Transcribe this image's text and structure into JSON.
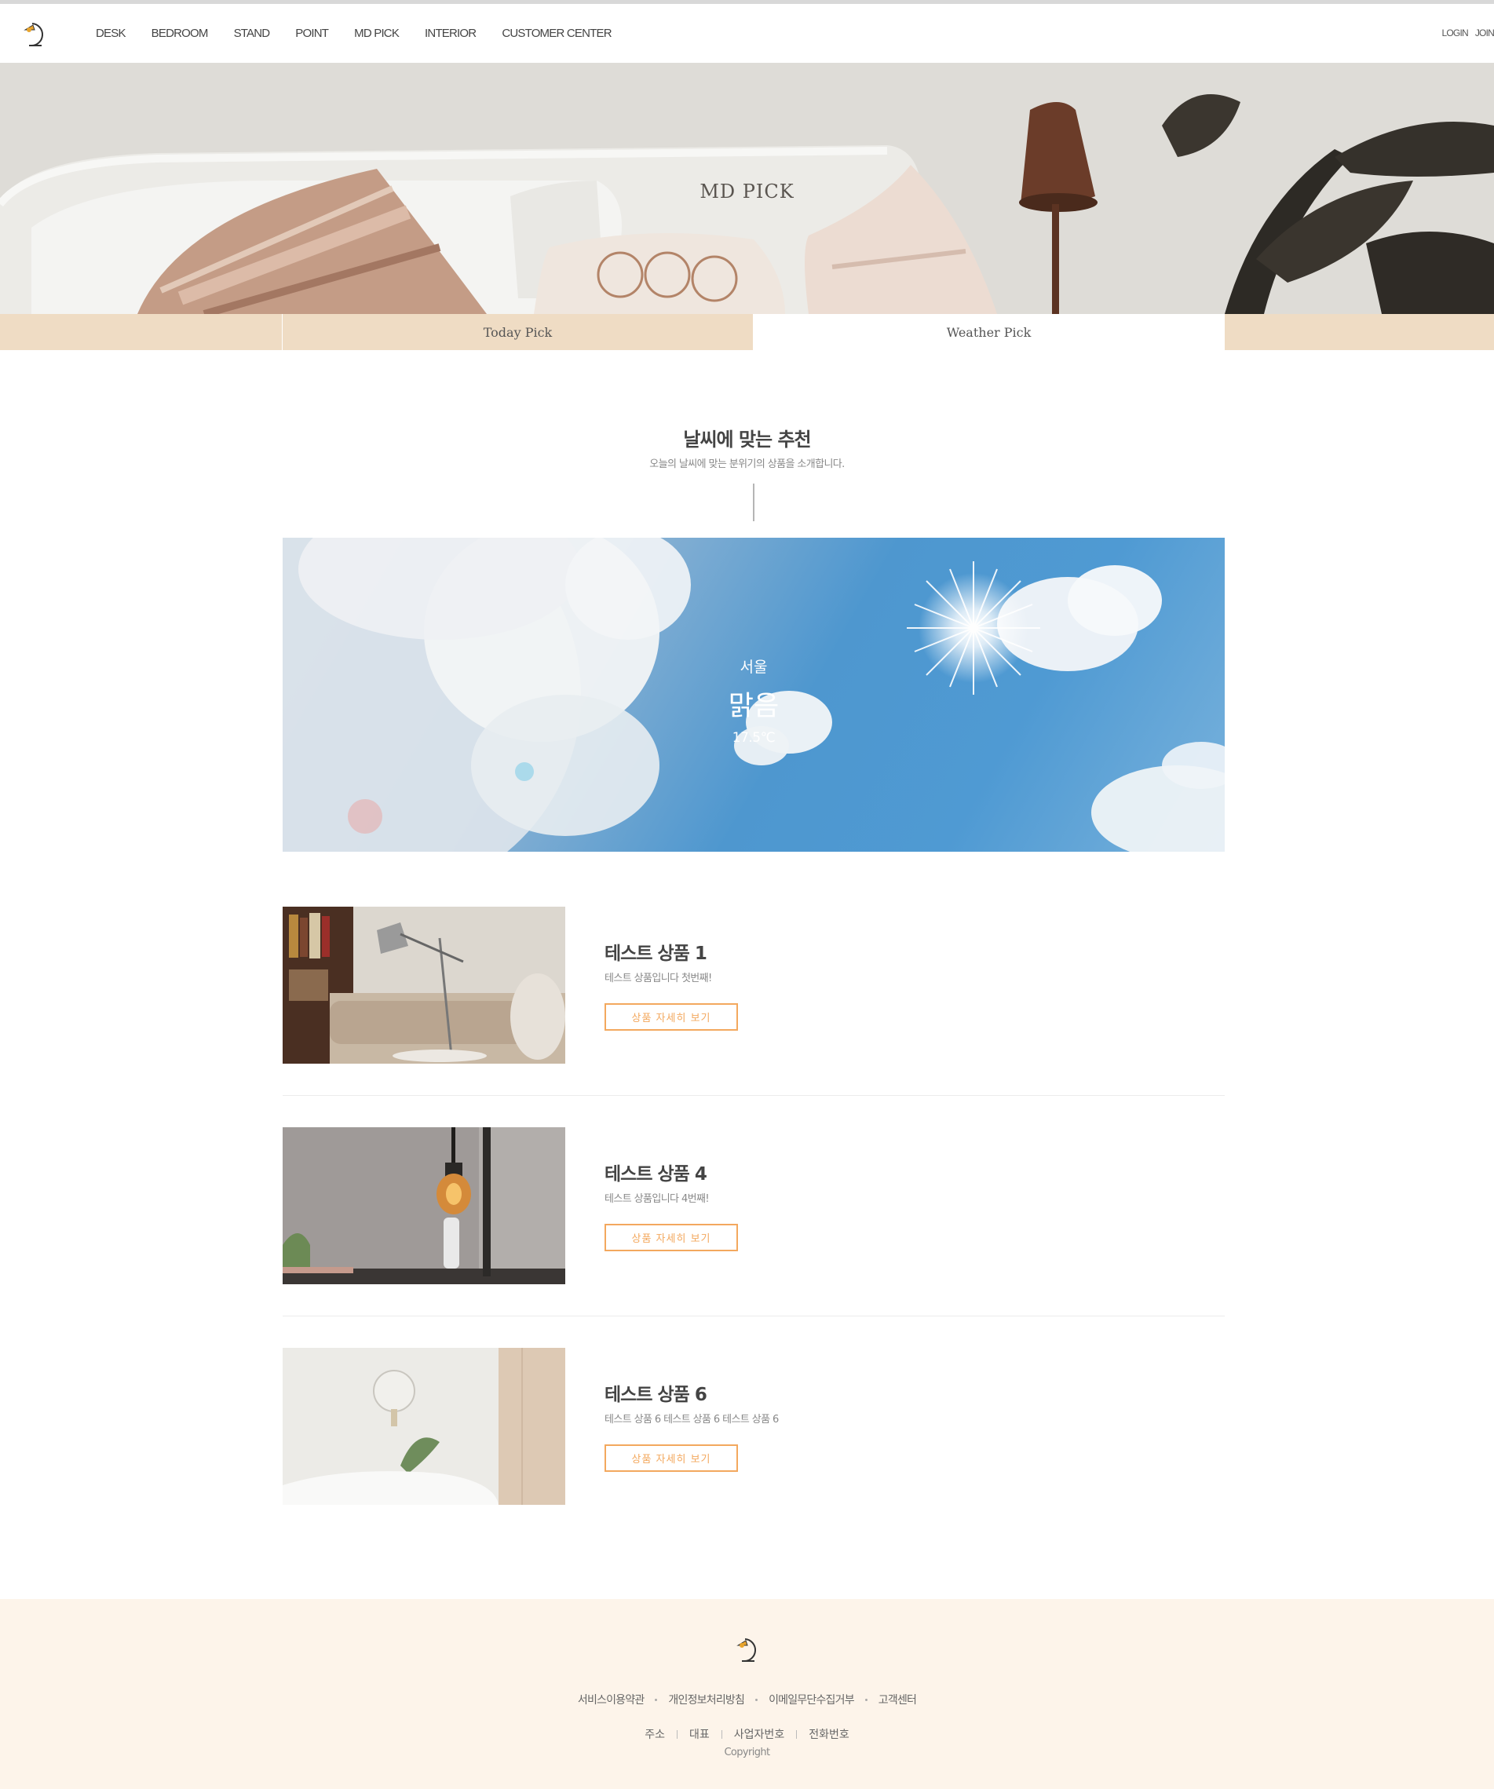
{
  "header": {
    "nav": [
      "DESK",
      "BEDROOM",
      "STAND",
      "POINT",
      "MD PICK",
      "INTERIOR",
      "CUSTOMER CENTER"
    ],
    "login_label": "LOGIN",
    "join_label": "JOIN"
  },
  "hero": {
    "title": "MD PICK"
  },
  "tabs": {
    "today_label": "Today Pick",
    "weather_label": "Weather Pick",
    "active": "Weather Pick"
  },
  "section": {
    "title": "날씨에 맞는 추천",
    "subtitle": "오늘의 날씨에 맞는 분위기의 상품을 소개합니다."
  },
  "weather": {
    "city": "서울",
    "condition": "맑음",
    "temperature": "17.5℃"
  },
  "products": [
    {
      "name": "테스트 상품 1",
      "desc": "테스트 상품입니다 첫번째!",
      "button": "상품 자세히 보기"
    },
    {
      "name": "테스트 상품 4",
      "desc": "테스트 상품입니다 4번째!",
      "button": "상품 자세히 보기"
    },
    {
      "name": "테스트 상품 6",
      "desc": "테스트 상품 6 테스트 상품 6 테스트 상품 6",
      "button": "상품 자세히 보기"
    }
  ],
  "footer": {
    "links": [
      "서비스이용약관",
      "개인정보처리방침",
      "이메일무단수집거부",
      "고객센터"
    ],
    "info": [
      "주소",
      "대표",
      "사업자번호",
      "전화번호"
    ],
    "copyright": "Copyright"
  },
  "colors": {
    "accent": "#f3a85e",
    "tab_bg": "#efdcc4",
    "footer_bg": "#fdf4ea",
    "logo_bulb": "#e8a42c"
  },
  "icons": {
    "logo": "desk-lamp-logo-icon"
  }
}
